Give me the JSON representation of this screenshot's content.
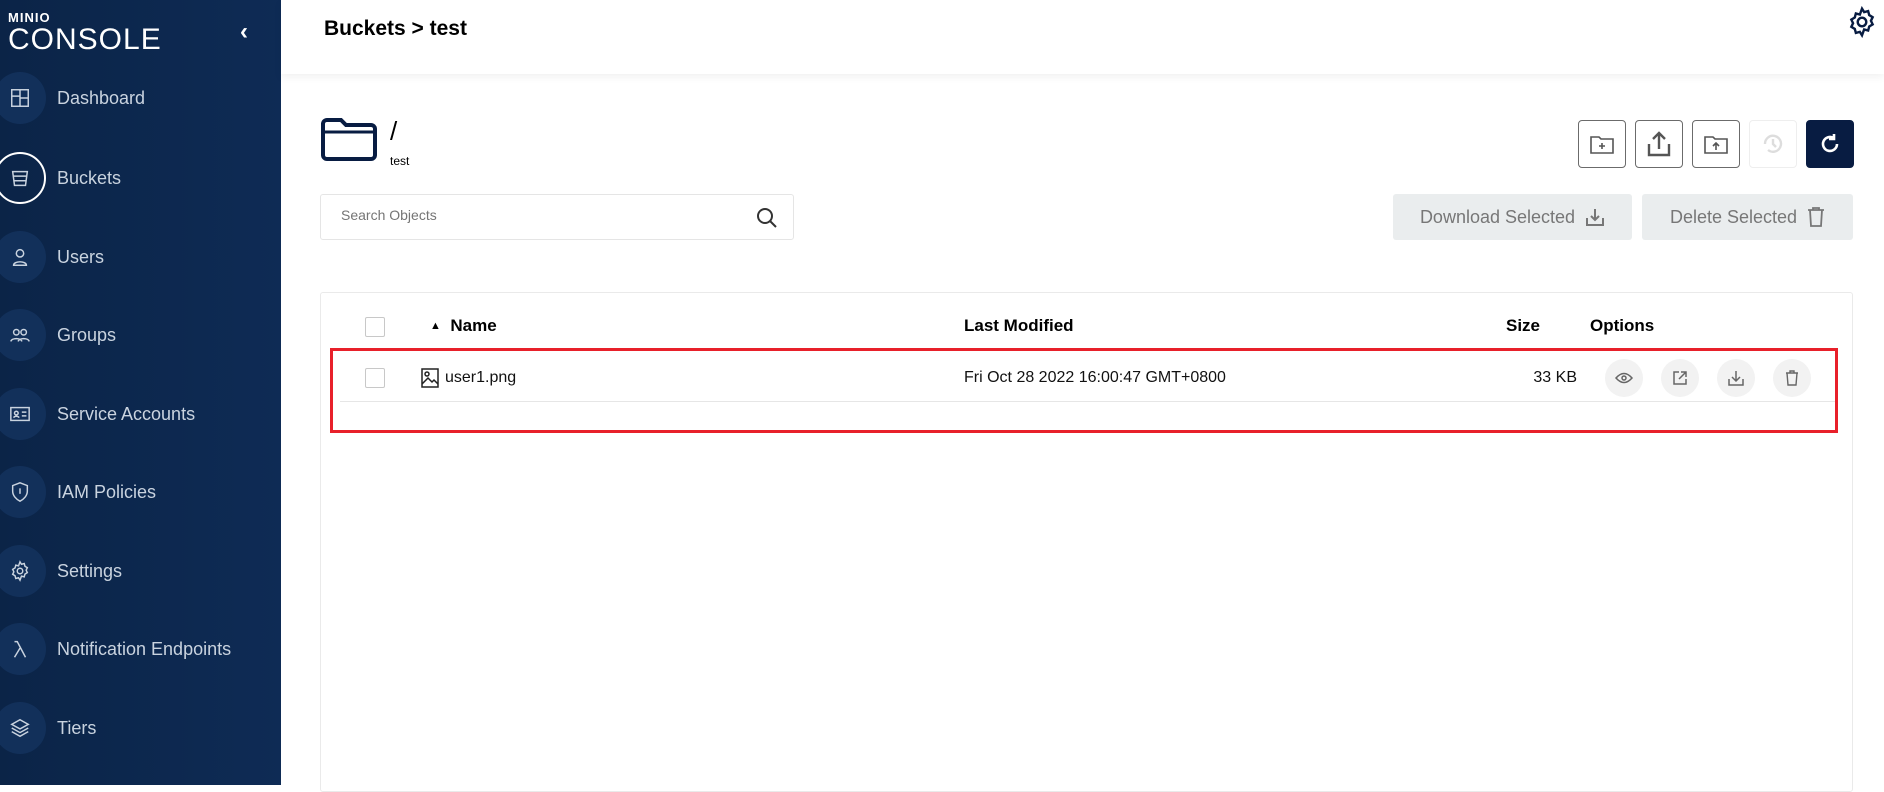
{
  "sidebar": {
    "logo_top": "MINIO",
    "logo_bottom": "CONSOLE",
    "items": [
      {
        "label": "Dashboard",
        "icon": "dashboard-icon"
      },
      {
        "label": "Buckets",
        "icon": "bucket-icon",
        "active": true
      },
      {
        "label": "Users",
        "icon": "user-icon"
      },
      {
        "label": "Groups",
        "icon": "groups-icon"
      },
      {
        "label": "Service Accounts",
        "icon": "id-card-icon"
      },
      {
        "label": "IAM Policies",
        "icon": "shield-icon"
      },
      {
        "label": "Settings",
        "icon": "gear-icon"
      },
      {
        "label": "Notification Endpoints",
        "icon": "lambda-icon"
      },
      {
        "label": "Tiers",
        "icon": "layers-icon"
      }
    ]
  },
  "header": {
    "title": "Buckets > test"
  },
  "browser": {
    "path": "/",
    "bucket": "test",
    "search_placeholder": "Search Objects",
    "download_selected": "Download Selected",
    "delete_selected": "Delete Selected"
  },
  "table": {
    "columns": {
      "name": "Name",
      "modified": "Last Modified",
      "size": "Size",
      "options": "Options"
    },
    "rows": [
      {
        "name": "user1.png",
        "modified": "Fri Oct 28 2022 16:00:47 GMT+0800",
        "size": "33 KB"
      }
    ]
  },
  "colors": {
    "sidebar": "#0b2447",
    "accent": "#081c42",
    "highlight": "#e8202a"
  }
}
